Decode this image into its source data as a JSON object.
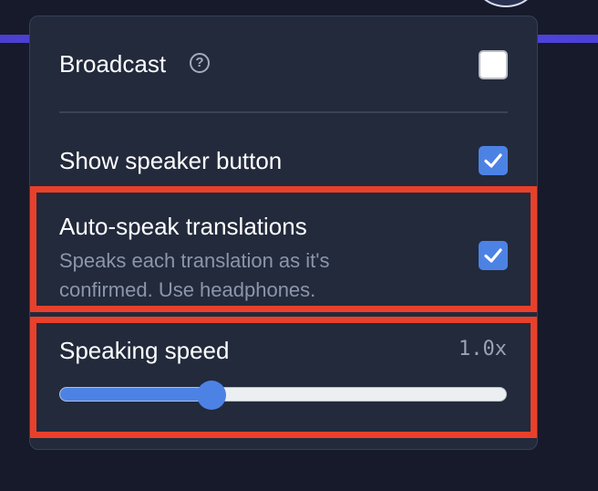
{
  "settings": {
    "broadcast": {
      "label": "Broadcast",
      "help_icon": "?",
      "checked": false
    },
    "show_speaker": {
      "label": "Show speaker button",
      "checked": true
    },
    "auto_speak": {
      "label": "Auto-speak translations",
      "description": "Speaks each translation as it's confirmed. Use headphones.",
      "checked": true
    },
    "speaking_speed": {
      "label": "Speaking speed",
      "value_text": "1.0x",
      "level": 0.34
    }
  },
  "colors": {
    "accent": "#4d82e5",
    "panel": "#222a3c",
    "highlight": "#e8402a"
  },
  "icons": [
    "help-circle-icon",
    "checkmark-icon"
  ]
}
